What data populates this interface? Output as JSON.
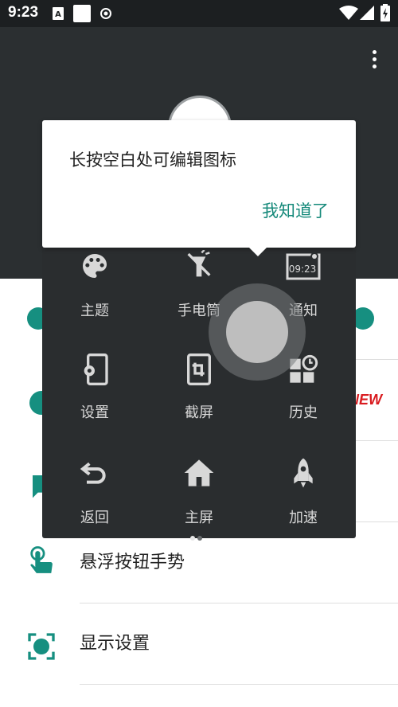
{
  "status_bar": {
    "time": "9:23",
    "icons": [
      "a-notification-icon",
      "square-notification-icon",
      "record-notification-icon",
      "wifi-icon",
      "signal-icon",
      "battery-charging-icon"
    ]
  },
  "header": {
    "menu_icon": "more-vertical-icon"
  },
  "tip": {
    "text": "长按空白处可编辑图标",
    "button": "我知道了"
  },
  "panel": {
    "items": [
      {
        "label": "主题",
        "icon": "palette-icon"
      },
      {
        "label": "手电筒",
        "icon": "flashlight-off-icon"
      },
      {
        "label": "通知",
        "icon": "notification-clock-icon",
        "icon_text": "09:23"
      },
      {
        "label": "设置",
        "icon": "phone-settings-icon"
      },
      {
        "label": "截屏",
        "icon": "screenshot-crop-icon"
      },
      {
        "label": "历史",
        "icon": "recent-apps-icon"
      },
      {
        "label": "返回",
        "icon": "back-arrow-icon"
      },
      {
        "label": "主屏",
        "icon": "home-icon"
      },
      {
        "label": "加速",
        "icon": "rocket-icon"
      }
    ],
    "page_count": 2,
    "active_page": 1
  },
  "list": {
    "new_badge": "NEW",
    "rows": [
      {
        "label": "悬浮按钮手势",
        "icon": "touch-gesture-icon"
      },
      {
        "label": "显示设置",
        "icon": "display-settings-icon"
      }
    ]
  },
  "colors": {
    "accent": "#168f80",
    "dark_bg": "#2b2f31",
    "panel_bg": "#2a2d2f",
    "badge": "#d91c20"
  }
}
